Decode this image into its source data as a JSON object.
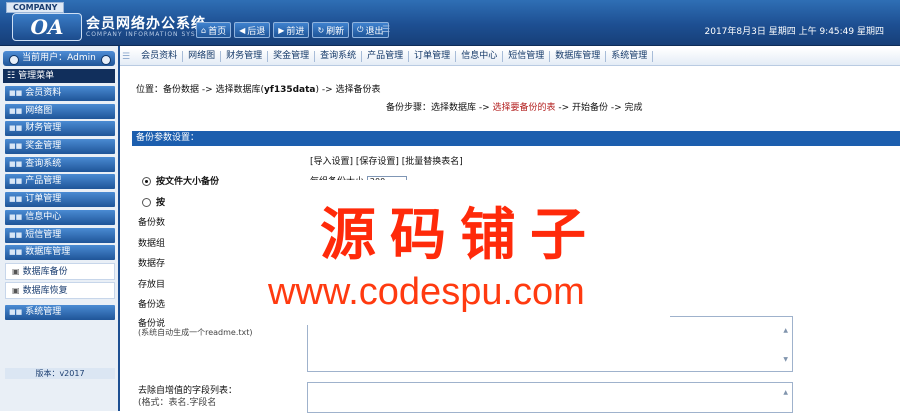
{
  "header": {
    "company_badge": "COMPANY",
    "logo_text": "OA",
    "title": "会员网络办公系统",
    "subtitle": "COMPANY INFORMATION SYSTEM",
    "quick_nav": [
      {
        "icon": "home-icon",
        "glyph": "⌂",
        "label": "首页"
      },
      {
        "icon": "back-icon",
        "glyph": "◀",
        "label": "后退"
      },
      {
        "icon": "forward-icon",
        "glyph": "▶",
        "label": "前进"
      },
      {
        "icon": "refresh-icon",
        "glyph": "↻",
        "label": "刷新"
      },
      {
        "icon": "logout-icon",
        "glyph": "⏻",
        "label": "退出"
      }
    ],
    "datetime": "2017年8月3日 星期四 上午 9:45:49 星期四"
  },
  "sidebar": {
    "current_user": "当前用户：Admin",
    "menu_head": "管理菜单",
    "items": [
      {
        "label": "会员资料"
      },
      {
        "label": "网络图"
      },
      {
        "label": "财务管理"
      },
      {
        "label": "奖金管理"
      },
      {
        "label": "查询系统"
      },
      {
        "label": "产品管理"
      },
      {
        "label": "订单管理"
      },
      {
        "label": "信息中心"
      },
      {
        "label": "短信管理"
      },
      {
        "label": "数据库管理"
      }
    ],
    "sub_items": [
      {
        "label": "数据库备份"
      },
      {
        "label": "数据库恢复"
      }
    ],
    "last_item": "系统管理",
    "version": "版本：v2017"
  },
  "tabs": [
    "会员资料",
    "网络图",
    "财务管理",
    "奖金管理",
    "查询系统",
    "产品管理",
    "订单管理",
    "信息中心",
    "短信管理",
    "数据库管理",
    "系统管理"
  ],
  "main": {
    "crumb_pre": "位置：备份数据 -> 选择数据库(",
    "crumb_db": "yf135data",
    "crumb_post": ") -> 选择备份表",
    "steps_pre": "备份步骤：选择数据库 -> ",
    "steps_cur": "选择要备份的表",
    "steps_post": " -> 开始备份 -> 完成",
    "panel_title": "备份参数设置：",
    "links": "[导入设置] [保存设置] [批量替换表名]",
    "opt_volume": "按文件大小备份",
    "volume_label": "每组备份大小",
    "volume_value": "200",
    "opt_single": "按",
    "label_a": "备份数",
    "label_b": "数据组",
    "label_c": "数据存",
    "label_d": "存放目",
    "label_e": "备份选",
    "label_f": "备份说",
    "readme_hint": "(系统自动生成一个readme.txt)",
    "auto_inc_label": "去除自增值的字段列表：",
    "auto_inc_hint": "(格式：表名.字段名"
  },
  "watermark": {
    "cn": "源码铺子",
    "url": "www.codespu.com"
  }
}
